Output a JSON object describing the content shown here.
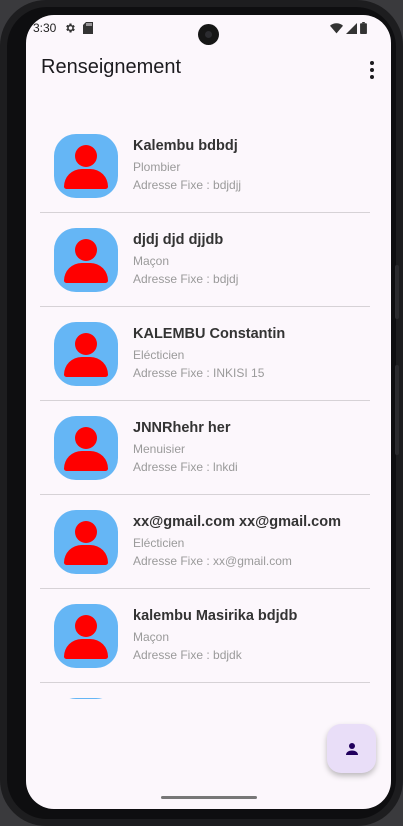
{
  "status_bar": {
    "time": "3:30"
  },
  "app_bar": {
    "title": "Renseignement"
  },
  "workers": [
    {
      "name": "Kalembu  bdbdj",
      "profession": "Plombier",
      "address": "Adresse Fixe : bdjdjj"
    },
    {
      "name": "djdj djd djjdb",
      "profession": "Maçon",
      "address": "Adresse Fixe : bdjdj"
    },
    {
      "name": "KALEMBU  Constantin",
      "profession": "Elécticien",
      "address": "Adresse Fixe : INKISI 15"
    },
    {
      "name": "JNNRhehr  her",
      "profession": "Menuisier",
      "address": "Adresse Fixe : lnkdi"
    },
    {
      "name": "xx@gmail.com xx@gmail.com",
      "profession": "Elécticien",
      "address": "Adresse Fixe : xx@gmail.com"
    },
    {
      "name": "kalembu Masirika  bdjdb",
      "profession": "Maçon",
      "address": "Adresse Fixe : bdjdk"
    }
  ],
  "colors": {
    "avatar_bg": "#65b6f5",
    "avatar_fg": "#ff0000",
    "fab_bg": "#e9def8",
    "screen_bg": "#fcf7fc"
  },
  "icons": {
    "fab": "person-icon",
    "menu": "more-vert-icon"
  }
}
